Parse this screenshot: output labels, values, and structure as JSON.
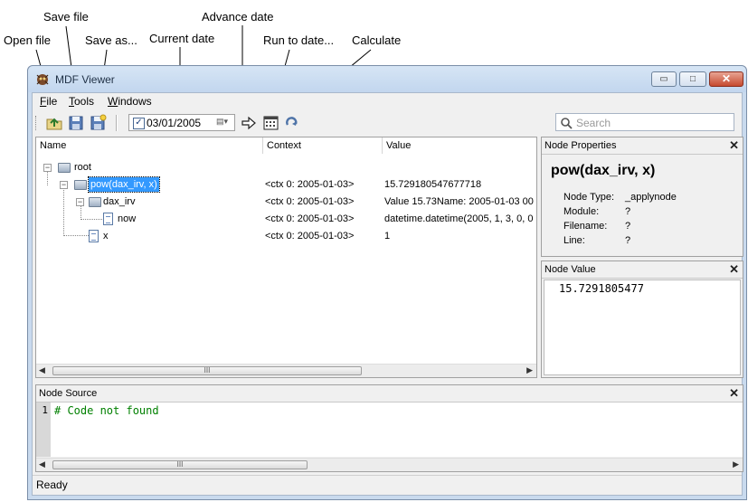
{
  "annotations": {
    "open_file": "Open file",
    "save_file": "Save file",
    "save_as": "Save as...",
    "current_date": "Current date",
    "advance_date": "Advance date",
    "run_to_date": "Run to date...",
    "calculate": "Calculate"
  },
  "window": {
    "title": "MDF Viewer",
    "minimize": "▭",
    "maximize": "□",
    "close": "✕"
  },
  "menu": {
    "file": "ile",
    "file_accel": "F",
    "tools": "ools",
    "tools_accel": "T",
    "windows": "indows",
    "windows_accel": "W"
  },
  "toolbar": {
    "date_value": "03/01/2005",
    "date_checked": true,
    "search_placeholder": "Search"
  },
  "tree": {
    "columns": [
      "Name",
      "Context",
      "Value"
    ],
    "rows": [
      {
        "name": "root",
        "context": "",
        "value": "",
        "icon": "folder-icon"
      },
      {
        "name": "pow(dax_irv, x)",
        "context": "<ctx 0: 2005-01-03>",
        "value": "15.729180547677718",
        "icon": "folder-icon",
        "selected": true
      },
      {
        "name": "dax_irv",
        "context": "<ctx 0: 2005-01-03>",
        "value": "Value    15.73Name: 2005-01-03 00",
        "icon": "folder-icon"
      },
      {
        "name": "now",
        "context": "<ctx 0: 2005-01-03>",
        "value": "datetime.datetime(2005, 1, 3, 0, 0",
        "icon": "file-icon"
      },
      {
        "name": "x",
        "context": "<ctx 0: 2005-01-03>",
        "value": "1",
        "icon": "file-icon"
      }
    ]
  },
  "node_properties": {
    "header": "Node Properties",
    "title": "pow(dax_irv, x)",
    "fields": [
      {
        "label": "Node Type:",
        "value": "_applynode"
      },
      {
        "label": "Module:",
        "value": "?"
      },
      {
        "label": "Filename:",
        "value": "?"
      },
      {
        "label": "Line:",
        "value": "?"
      }
    ]
  },
  "node_value": {
    "header": "Node Value",
    "value": "15.7291805477"
  },
  "node_source": {
    "header": "Node Source",
    "line_number": "1",
    "code": "# Code not found"
  },
  "status": "Ready",
  "colors": {
    "selection": "#3399ff",
    "code_comment": "#008000"
  }
}
